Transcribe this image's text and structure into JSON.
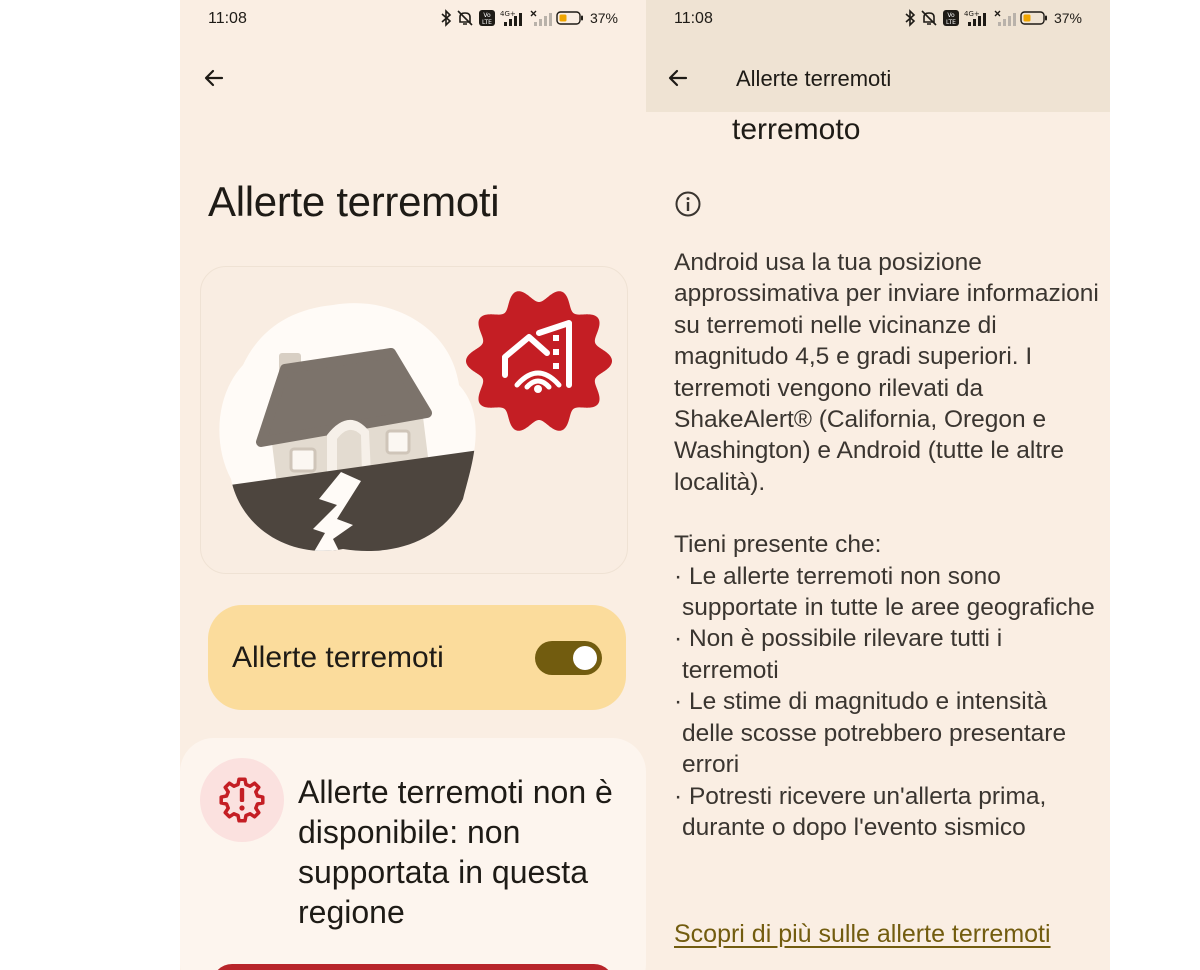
{
  "left_screen": {
    "status": {
      "time": "11:08",
      "battery": "37%"
    },
    "title": "Allerte terremoti",
    "toggle": {
      "label": "Allerte terremoti",
      "state": "on"
    },
    "unavailable_message": "Allerte terremoti non è disponibile: non supportata in questa regione"
  },
  "right_screen": {
    "status": {
      "time": "11:08",
      "battery": "37%"
    },
    "appbar_title": "Allerte terremoti",
    "partial_heading": "terremoto",
    "description": "Android usa la tua posizione approssimativa per inviare informazioni su terremoti nelle vicinanze di magnitudo 4,5 e gradi superiori. I terremoti vengono rilevati da ShakeAlert® (California, Oregon e Washington) e Android (tutte le altre località).",
    "notes_heading": "Tieni presente che:",
    "notes": [
      "· Le allerte terremoti non sono supportate in tutte le aree geografiche",
      "· Non è possibile rilevare tutti i terremoti",
      "· Le stime di magnitudo e intensità delle scosse potrebbero presentare errori",
      "· Potresti ricevere un'allerta prima, durante o dopo l'evento sismico"
    ],
    "learn_more_link": "Scopri di più sulle allerte terremoti"
  },
  "colors": {
    "background": "#faeee3",
    "toggle_card": "#fbdc9c",
    "switch_track": "#725c0f",
    "alert_red": "#c41e24",
    "link": "#725c0f"
  },
  "icons": {
    "status_bar": [
      "bluetooth-icon",
      "silent-icon",
      "volte-icon",
      "signal-4g-icon",
      "signal-no-sim-icon",
      "battery-icon"
    ],
    "back": "arrow-back-icon",
    "illustration_badge": "house-alert-icon",
    "warning": "gear-alert-icon",
    "info": "info-icon"
  }
}
